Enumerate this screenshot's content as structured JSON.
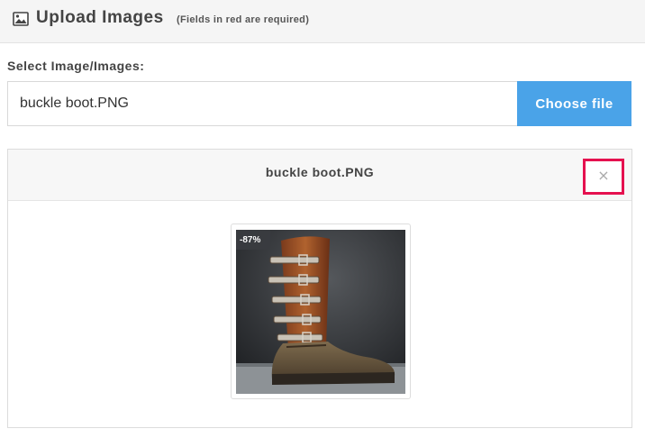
{
  "header": {
    "title": "Upload Images",
    "note": "(Fields in red are required)",
    "icon": "image-icon"
  },
  "form": {
    "select_label": "Select Image/Images:",
    "file_name": "buckle boot.PNG",
    "choose_button_label": "Choose file"
  },
  "preview": {
    "title": "buckle boot.PNG",
    "close_label": "×",
    "badge": "-87%"
  },
  "colors": {
    "accent_button": "#4aa3e8",
    "close_highlight": "#e5114f"
  }
}
